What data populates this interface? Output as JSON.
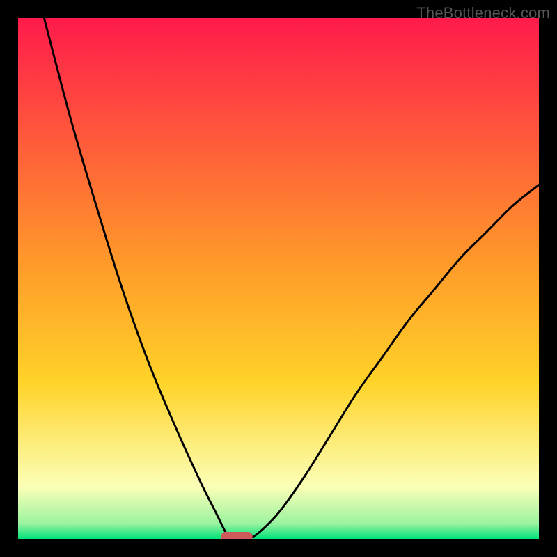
{
  "watermark": "TheBottleneck.com",
  "chart_data": {
    "type": "line",
    "title": "",
    "xlabel": "",
    "ylabel": "",
    "xlim": [
      0,
      100
    ],
    "ylim": [
      0,
      100
    ],
    "grid": false,
    "annotations": [],
    "legend": [],
    "series": [
      {
        "name": "left-curve",
        "x": [
          5,
          10,
          15,
          20,
          25,
          30,
          35,
          38,
          40,
          41
        ],
        "values": [
          100,
          81,
          64,
          48,
          34,
          22,
          11,
          5,
          1,
          0
        ]
      },
      {
        "name": "right-curve",
        "x": [
          44,
          46,
          50,
          55,
          60,
          65,
          70,
          75,
          80,
          85,
          90,
          95,
          100
        ],
        "values": [
          0,
          1,
          5,
          12,
          20,
          28,
          35,
          42,
          48,
          54,
          59,
          64,
          68
        ]
      }
    ],
    "marker": {
      "name": "optimal-marker",
      "x_range": [
        39,
        45
      ],
      "y": 0,
      "color": "#cf5a5c"
    },
    "background_gradient": {
      "top": "#ff1b4b",
      "mid_upper": "#ffd328",
      "mid_lower": "#fbffb7",
      "bottom": "#00e27a"
    },
    "curve_color": "#000000",
    "frame_color": "#000000"
  }
}
